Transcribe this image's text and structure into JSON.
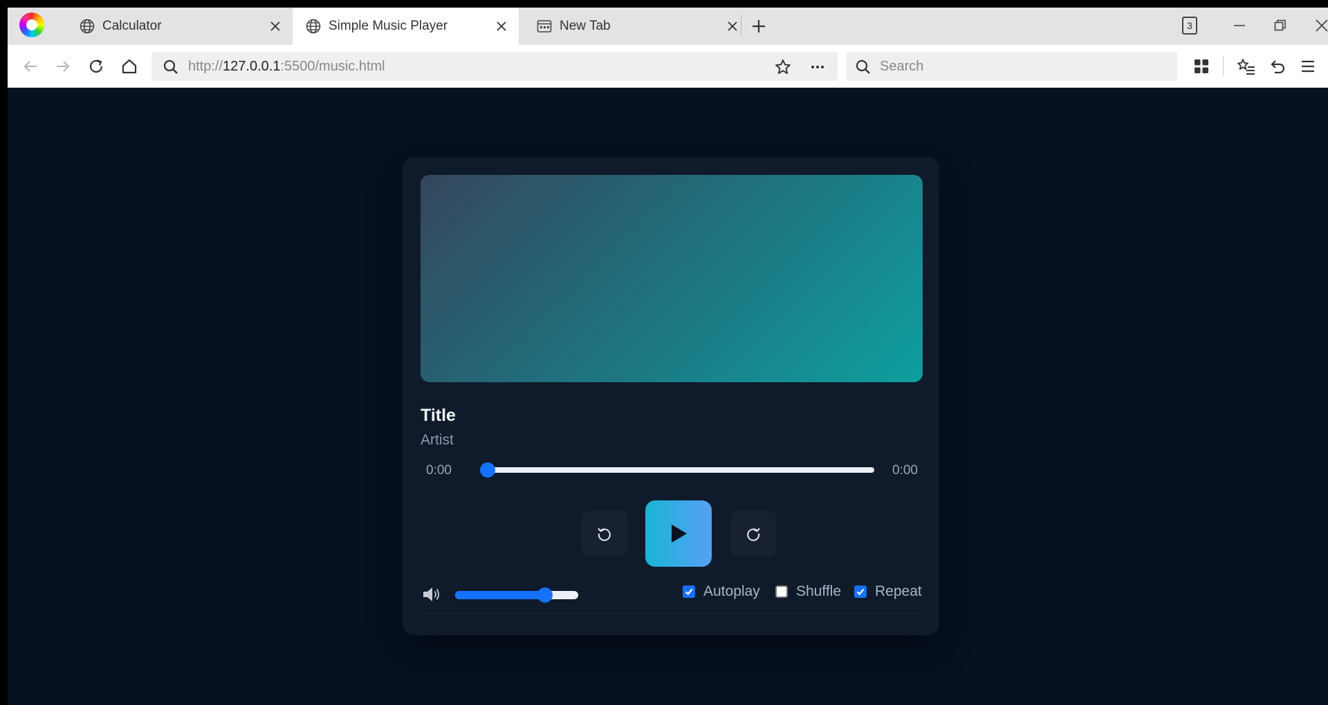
{
  "browser": {
    "tabs": [
      {
        "label": "Calculator",
        "active": false
      },
      {
        "label": "Simple Music Player",
        "active": true
      },
      {
        "label": "New Tab",
        "active": false
      }
    ],
    "tab_count": "3",
    "url": {
      "scheme": "http://",
      "host": "127.0.0.1",
      "rest": ":5500/music.html"
    },
    "search_placeholder": "Search"
  },
  "player": {
    "title": "Title",
    "artist": "Artist",
    "current_time": "0:00",
    "duration": "0:00",
    "progress_fraction": 0.0,
    "volume_fraction": 0.76,
    "options": [
      {
        "label": "Autoplay",
        "checked": true
      },
      {
        "label": "Shuffle",
        "checked": false
      },
      {
        "label": "Repeat",
        "checked": true
      }
    ],
    "colors": {
      "accent": "#1572ff",
      "page_bg": "#061121",
      "card_bg": "#0f1a2a",
      "play_gradient_start": "#18b5d4",
      "play_gradient_end": "#58a0f5"
    }
  }
}
